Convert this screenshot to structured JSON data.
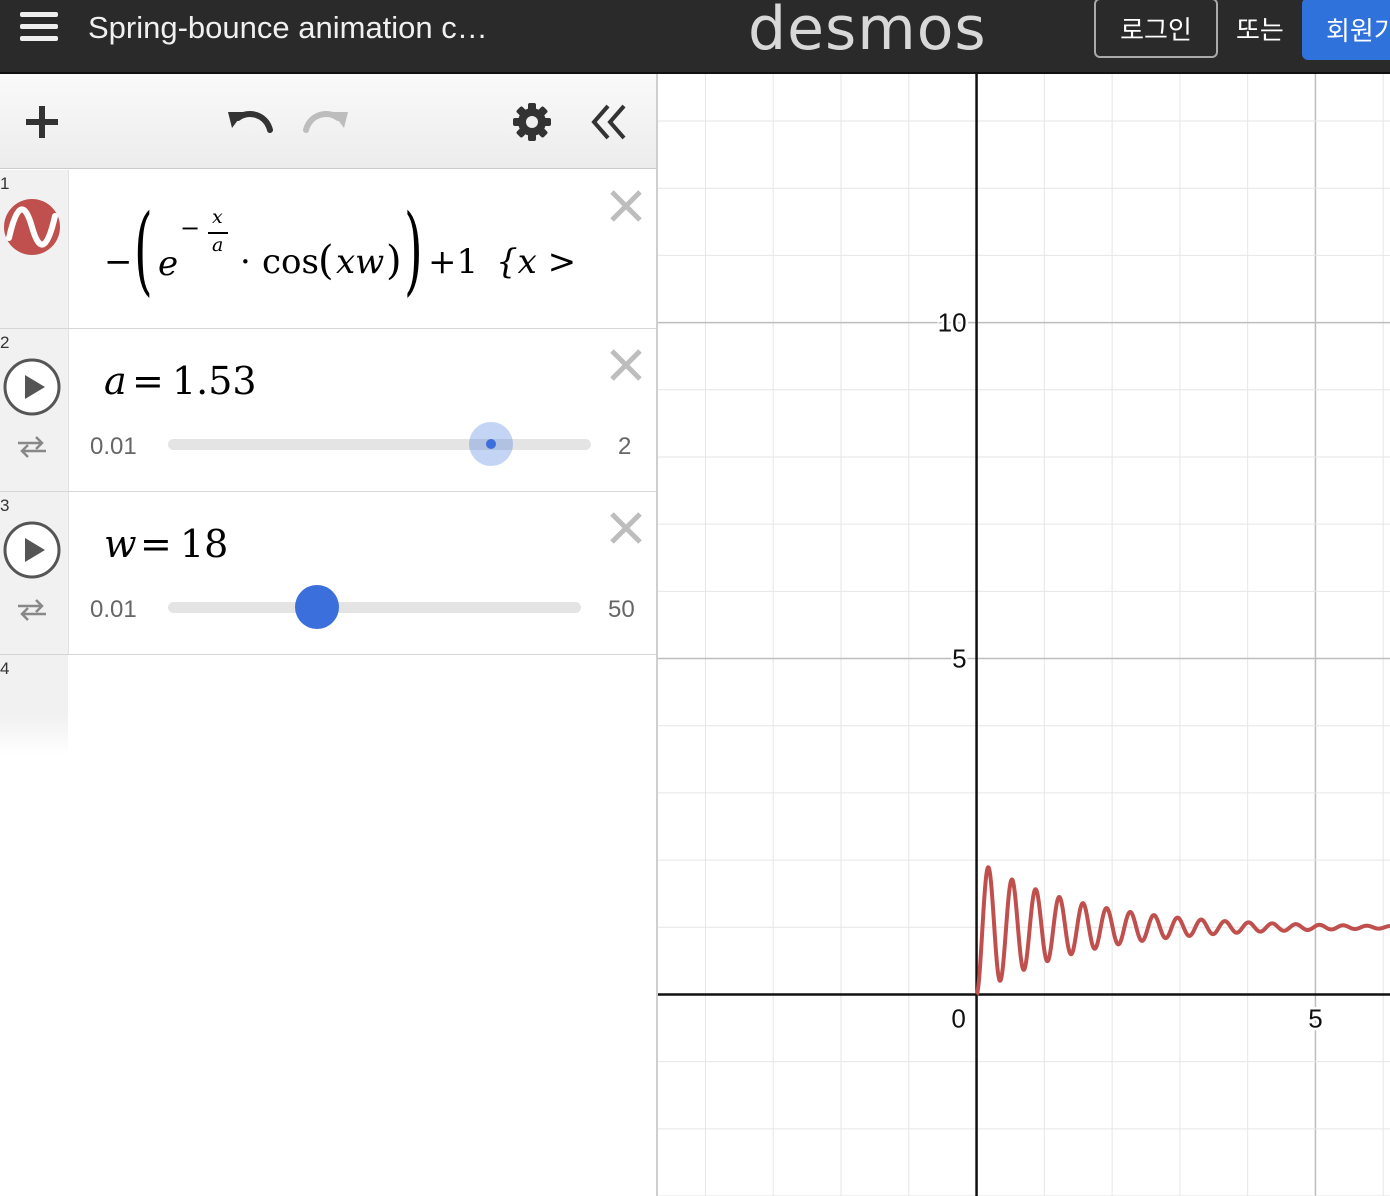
{
  "header": {
    "title": "Spring-bounce animation c…",
    "logo": "desmos",
    "login_label": "로그인",
    "or_label": "또는",
    "signup_label": "회원가입"
  },
  "expressions": [
    {
      "index": "1",
      "color": "#c0504d",
      "latex_parts": {
        "neg": "−",
        "e": "e",
        "exp_neg": "−",
        "exp_num": "x",
        "exp_den": "a",
        "dot": "·",
        "cos": "cos",
        "arg": "xw",
        "plus_one": "+1",
        "cond": "{x >"
      }
    },
    {
      "index": "2",
      "variable": "a",
      "equals": "=",
      "value": "1.53",
      "slider": {
        "min": "0.01",
        "max": "2",
        "value": 1.53
      }
    },
    {
      "index": "3",
      "variable": "w",
      "equals": "=",
      "value": "18",
      "slider": {
        "min": "0.01",
        "max": "50",
        "value": 18
      }
    },
    {
      "index": "4"
    }
  ],
  "colors": {
    "curve": "#c0504d",
    "slider_thumb": "#3a6fdc",
    "accent": "#2f72dc"
  },
  "icons": [
    "menu-icon",
    "plus-icon",
    "undo-icon",
    "redo-icon",
    "gear-icon",
    "collapse-icon",
    "close-icon",
    "play-icon",
    "loop-icon",
    "function-icon"
  ],
  "graph": {
    "x_labels": [
      "0",
      "5"
    ],
    "y_labels": [
      "10",
      "5"
    ],
    "xlim": [
      -4.7,
      6.1
    ],
    "ylim": [
      -3,
      13.7
    ],
    "grid": true
  }
}
